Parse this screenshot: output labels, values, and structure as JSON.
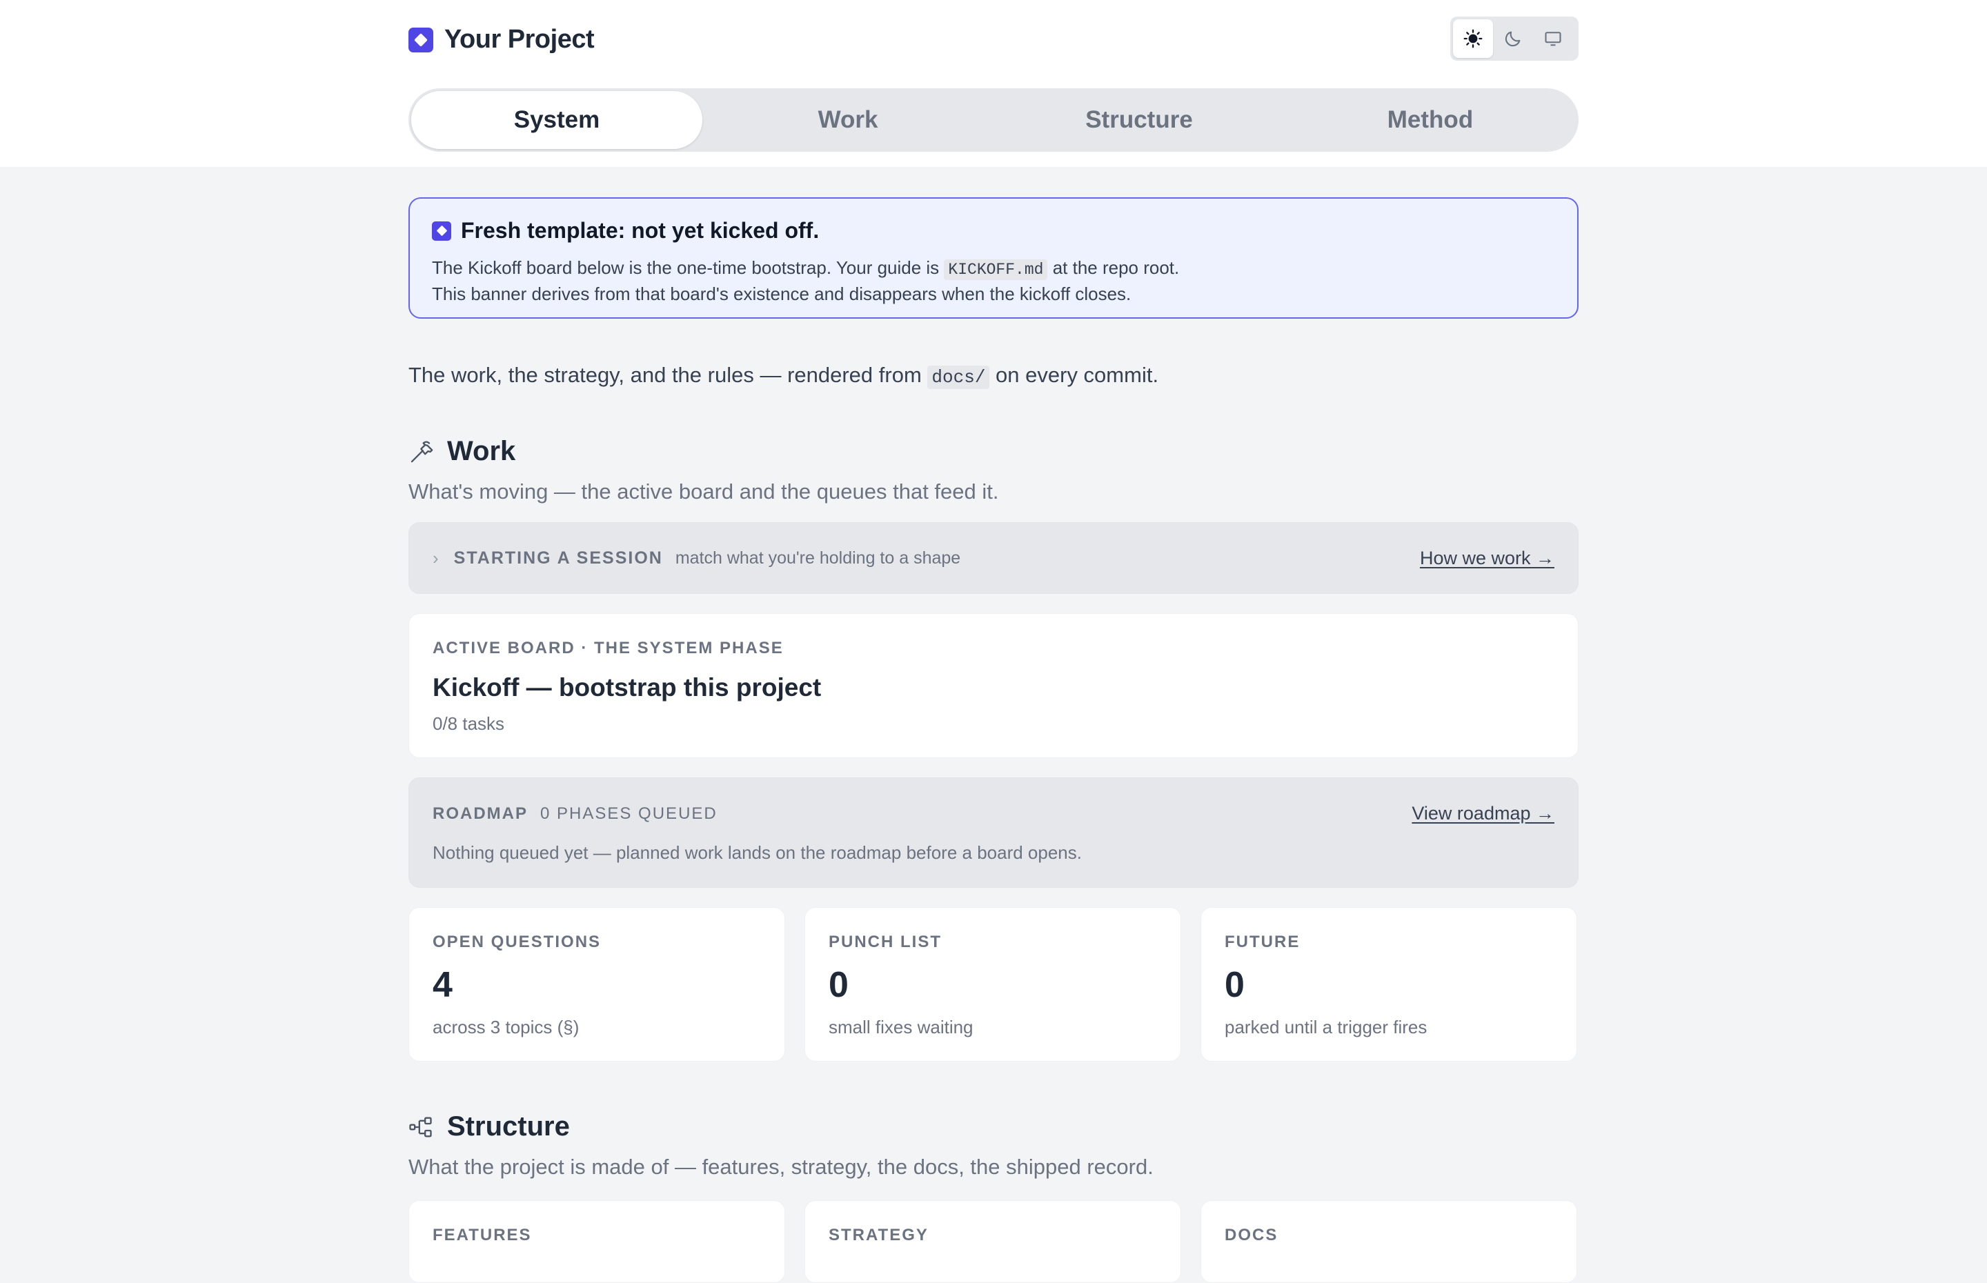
{
  "app": {
    "title": "Your Project"
  },
  "theme": {
    "options": [
      "light",
      "dark",
      "system"
    ],
    "selected": "light"
  },
  "tabs": [
    {
      "label": "System",
      "active": true
    },
    {
      "label": "Work",
      "active": false
    },
    {
      "label": "Structure",
      "active": false
    },
    {
      "label": "Method",
      "active": false
    }
  ],
  "banner": {
    "title": "Fresh template: not yet kicked off.",
    "line1_pre": "The Kickoff board below is the one-time bootstrap. Your guide is",
    "line1_code": "KICKOFF.md",
    "line1_post": "at the repo root.",
    "line2": "This banner derives from that board's existence and disappears when the kickoff closes."
  },
  "lede": {
    "pre": "The work, the strategy, and the rules — rendered from",
    "code": "docs/",
    "post": "on every commit."
  },
  "work": {
    "title": "Work",
    "subtitle": "What's moving — the active board and the queues that feed it.",
    "session": {
      "label": "STARTING A SESSION",
      "desc": "match what you're holding to a shape",
      "link": "How we work →"
    },
    "active_board": {
      "eyebrow": "ACTIVE BOARD · THE SYSTEM PHASE",
      "title": "Kickoff — bootstrap this project",
      "meta": "0/8 tasks"
    },
    "roadmap": {
      "label": "ROADMAP",
      "count": "0 PHASES QUEUED",
      "link": "View roadmap →",
      "body": "Nothing queued yet — planned work lands on the roadmap before a board opens."
    },
    "stats": [
      {
        "label": "OPEN QUESTIONS",
        "value": "4",
        "sub": "across 3 topics (§)"
      },
      {
        "label": "PUNCH LIST",
        "value": "0",
        "sub": "small fixes waiting"
      },
      {
        "label": "FUTURE",
        "value": "0",
        "sub": "parked until a trigger fires"
      }
    ]
  },
  "structure": {
    "title": "Structure",
    "subtitle": "What the project is made of — features, strategy, the docs, the shipped record.",
    "cards": [
      {
        "label": "FEATURES"
      },
      {
        "label": "STRATEGY"
      },
      {
        "label": "DOCS"
      }
    ]
  }
}
